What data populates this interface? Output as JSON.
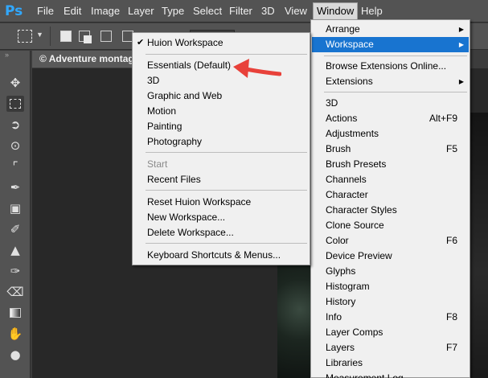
{
  "app": {
    "logo": "Ps"
  },
  "menubar": [
    "File",
    "Edit",
    "Image",
    "Layer",
    "Type",
    "Select",
    "Filter",
    "3D",
    "View",
    "Window",
    "Help"
  ],
  "document": {
    "tab_title": "© Adventure montage"
  },
  "window_menu": {
    "items": [
      "Arrange",
      "Workspace",
      "Browse Extensions Online...",
      "Extensions",
      "3D",
      "Actions",
      "Adjustments",
      "Brush",
      "Brush Presets",
      "Channels",
      "Character",
      "Character Styles",
      "Clone Source",
      "Color",
      "Device Preview",
      "Glyphs",
      "Histogram",
      "History",
      "Info",
      "Layer Comps",
      "Layers",
      "Libraries",
      "Measurement Log"
    ],
    "shortcuts": {
      "actions": "Alt+F9",
      "brush": "F5",
      "color": "F6",
      "info": "F8",
      "layers": "F7"
    }
  },
  "workspace_menu": {
    "checked": "Huion Workspace",
    "presets": [
      "Essentials (Default)",
      "3D",
      "Graphic and Web",
      "Motion",
      "Painting",
      "Photography"
    ],
    "start": "Start",
    "recent": "Recent Files",
    "actions": [
      "Reset Huion Workspace",
      "New Workspace...",
      "Delete Workspace..."
    ],
    "keyboard": "Keyboard Shortcuts & Menus..."
  },
  "colors": {
    "highlight": "#1874d0",
    "annotation": "#e8413a",
    "ps_blue": "#31a8ff"
  },
  "tools": [
    "move-tool",
    "rectangular-marquee-tool",
    "lasso-tool",
    "quick-selection-tool",
    "crop-tool",
    "eyedropper-tool",
    "spot-healing-tool",
    "brush-tool",
    "clone-stamp-tool",
    "history-brush-tool",
    "eraser-tool",
    "gradient-tool",
    "smudge-tool",
    "dodge-tool"
  ]
}
